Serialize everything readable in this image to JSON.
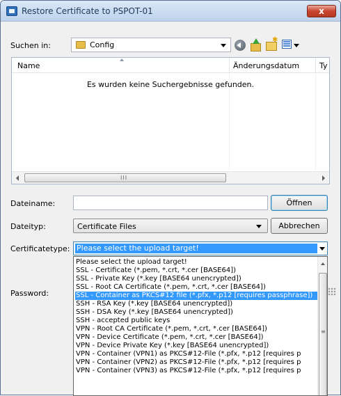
{
  "window": {
    "title": "Restore Certificate to PSPOT-01",
    "close_label": "x"
  },
  "lookin": {
    "label": "Suchen in:",
    "value": "Config"
  },
  "toolbar": {
    "icons": [
      "back-icon",
      "up-folder-icon",
      "new-folder-icon",
      "views-menu-icon"
    ]
  },
  "filelist": {
    "columns": [
      "Name",
      "Änderungsdatum",
      "Ty"
    ],
    "empty_message": "Es wurden keine Suchergebnisse gefunden.",
    "scroll_grip": "III"
  },
  "filename": {
    "label": "Dateiname:",
    "value": ""
  },
  "filetype": {
    "label": "Dateityp:",
    "value": "Certificate Files"
  },
  "buttons": {
    "open": "Öffnen",
    "cancel": "Abbrechen"
  },
  "certtype": {
    "label": "Certificatetype:",
    "selected": "Please select the upload target!",
    "options": [
      "Please select the upload target!",
      "SSL - Certificate (*.pem, *.crt, *.cer [BASE64])",
      "SSL - Private Key (*.key [BASE64 unencrypted])",
      "SSL - Root CA Certificate (*.pem, *.crt, *.cer [BASE64])",
      "SSL - Container as PKCS#12 file (*.pfx, *.p12 [requires passphrase])",
      "SSH - RSA Key (*.key [BASE64 unencrypted])",
      "SSH - DSA Key (*.key [BASE64 unencrypted])",
      "SSH - accepted public keys",
      "VPN - Root CA Certificate (*.pem, *.crt, *.cer [BASE64])",
      "VPN - Device Certificate (*.pem, *.crt, *.cer [BASE64])",
      "VPN - Device Private Key (*.key [BASE64 unencrypted])",
      "VPN - Container (VPN1) as PKCS#12-File (*.pfx, *.p12 [requires p",
      "VPN - Container (VPN2) as PKCS#12-File (*.pfx, *.p12 [requires p",
      "VPN - Container (VPN3) as PKCS#12-File (*.pfx, *.p12 [requires p"
    ],
    "highlighted_index": 4
  },
  "password": {
    "label": "Password:"
  },
  "colors": {
    "selection": "#3399ff",
    "dialog_bg": "#f0f0f0",
    "close_red": "#c8462f"
  }
}
